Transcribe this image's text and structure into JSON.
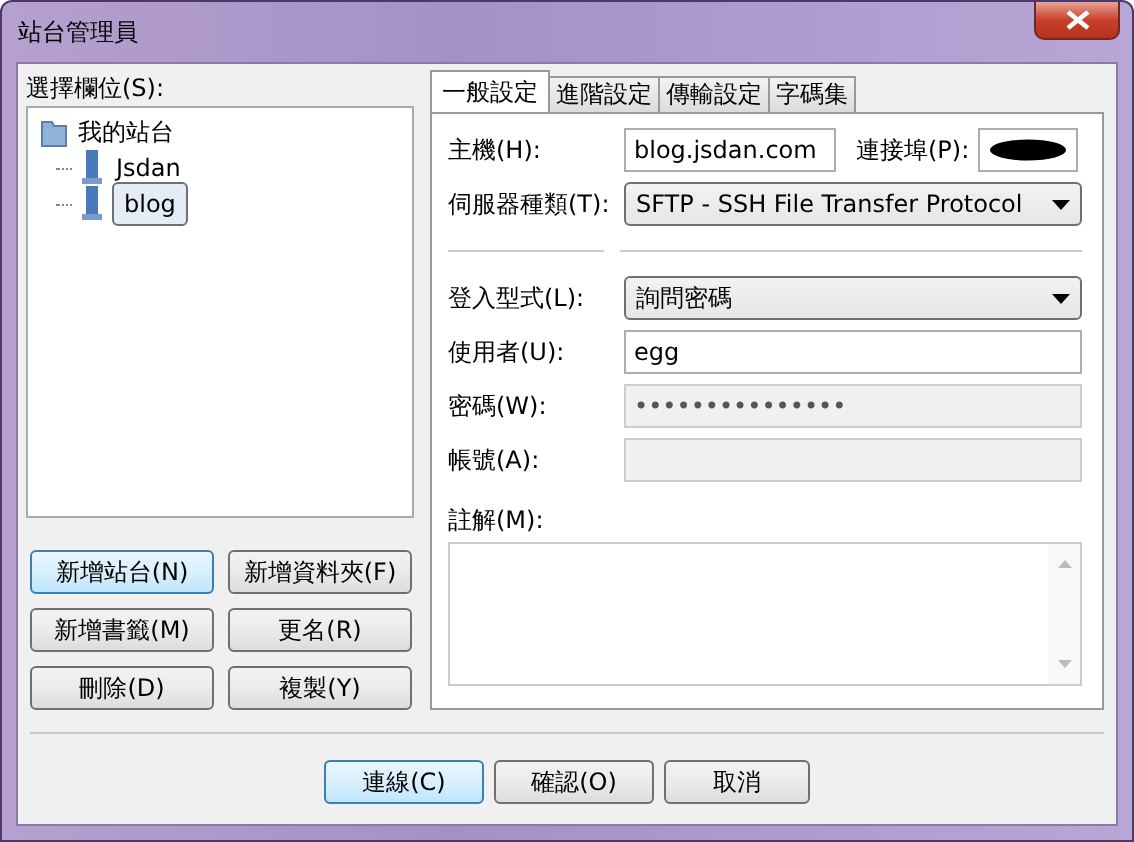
{
  "window": {
    "title": "站台管理員"
  },
  "tree": {
    "label": "選擇欄位(S):",
    "root": {
      "label": "我的站台",
      "children": [
        {
          "label": "Jsdan",
          "selected": false
        },
        {
          "label": "blog",
          "selected": true
        }
      ]
    }
  },
  "site_buttons": [
    {
      "label": "新增站台(N)",
      "default": true
    },
    {
      "label": "新增資料夾(F)",
      "default": false
    },
    {
      "label": "新增書籤(M)",
      "default": false
    },
    {
      "label": "更名(R)",
      "default": false
    },
    {
      "label": "刪除(D)",
      "default": false
    },
    {
      "label": "複製(Y)",
      "default": false
    }
  ],
  "tabs": [
    {
      "label": "一般設定",
      "selected": true
    },
    {
      "label": "進階設定",
      "selected": false
    },
    {
      "label": "傳輸設定",
      "selected": false
    },
    {
      "label": "字碼集",
      "selected": false
    }
  ],
  "general": {
    "host_label": "主機(H):",
    "host": "blog.jsdan.com",
    "port_label": "連接埠(P):",
    "port_redacted": true,
    "server_type_label": "伺服器種類(T):",
    "server_type": "SFTP - SSH File Transfer Protocol",
    "fields": [
      {
        "kind": "select",
        "label": "登入型式(L):",
        "value": "詢問密碼",
        "disabled": false
      },
      {
        "kind": "text",
        "label": "使用者(U):",
        "value": "egg",
        "disabled": false
      },
      {
        "kind": "password",
        "label": "密碼(W):",
        "value": "•••••••••••••••",
        "disabled": true
      },
      {
        "kind": "text",
        "label": "帳號(A):",
        "disabled": true
      }
    ],
    "comment_label": "註解(M):"
  },
  "buttons": [
    {
      "label": "連線(C)",
      "default": true
    },
    {
      "label": "確認(O)",
      "default": false
    },
    {
      "label": "取消",
      "default": false
    }
  ]
}
